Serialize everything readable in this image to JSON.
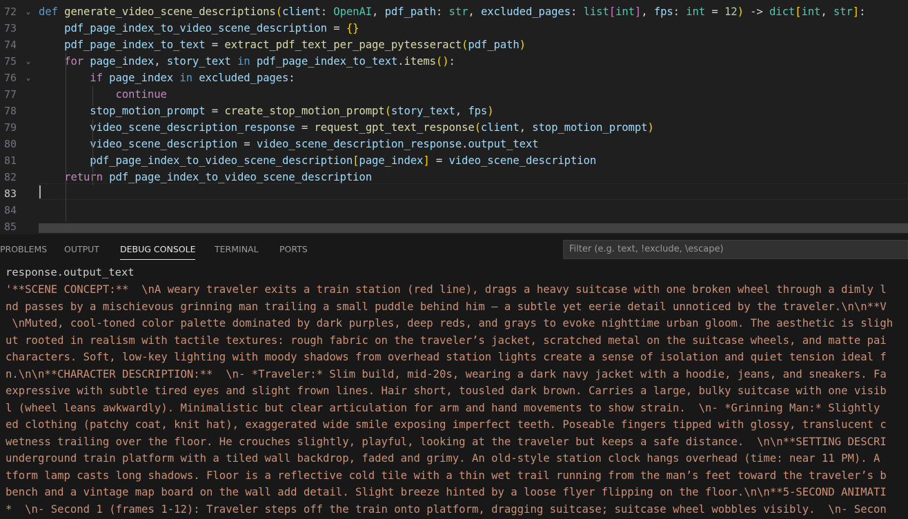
{
  "editor": {
    "lines": [
      {
        "num": "72",
        "fold": "⌄",
        "tokens": [
          {
            "t": "def",
            "c": "kw"
          },
          {
            "t": " ",
            "c": "pl"
          },
          {
            "t": "generate_video_scene_descriptions",
            "c": "fn"
          },
          {
            "t": "(",
            "c": "br1"
          },
          {
            "t": "client",
            "c": "var"
          },
          {
            "t": ": ",
            "c": "pl"
          },
          {
            "t": "OpenAI",
            "c": "typ"
          },
          {
            "t": ", ",
            "c": "pl"
          },
          {
            "t": "pdf_path",
            "c": "var"
          },
          {
            "t": ": ",
            "c": "pl"
          },
          {
            "t": "str",
            "c": "typ"
          },
          {
            "t": ", ",
            "c": "pl"
          },
          {
            "t": "excluded_pages",
            "c": "var"
          },
          {
            "t": ": ",
            "c": "pl"
          },
          {
            "t": "list",
            "c": "typ"
          },
          {
            "t": "[",
            "c": "br2"
          },
          {
            "t": "int",
            "c": "typ"
          },
          {
            "t": "]",
            "c": "br2"
          },
          {
            "t": ", ",
            "c": "pl"
          },
          {
            "t": "fps",
            "c": "var"
          },
          {
            "t": ": ",
            "c": "pl"
          },
          {
            "t": "int",
            "c": "typ"
          },
          {
            "t": " = ",
            "c": "pl"
          },
          {
            "t": "12",
            "c": "num"
          },
          {
            "t": ")",
            "c": "br1"
          },
          {
            "t": " -> ",
            "c": "pl"
          },
          {
            "t": "dict",
            "c": "typ"
          },
          {
            "t": "[",
            "c": "br1"
          },
          {
            "t": "int",
            "c": "typ"
          },
          {
            "t": ", ",
            "c": "pl"
          },
          {
            "t": "str",
            "c": "typ"
          },
          {
            "t": "]",
            "c": "br1"
          },
          {
            "t": ":",
            "c": "pl"
          }
        ]
      },
      {
        "num": "73",
        "fold": "",
        "tokens": [
          {
            "t": "    pdf_page_index_to_video_scene_description",
            "c": "var"
          },
          {
            "t": " = ",
            "c": "pl"
          },
          {
            "t": "{}",
            "c": "br1"
          }
        ]
      },
      {
        "num": "74",
        "fold": "",
        "tokens": [
          {
            "t": "    pdf_page_index_to_text",
            "c": "var"
          },
          {
            "t": " = ",
            "c": "pl"
          },
          {
            "t": "extract_pdf_text_per_page_pytesseract",
            "c": "fn"
          },
          {
            "t": "(",
            "c": "br1"
          },
          {
            "t": "pdf_path",
            "c": "var"
          },
          {
            "t": ")",
            "c": "br1"
          }
        ]
      },
      {
        "num": "75",
        "fold": "⌄",
        "tokens": [
          {
            "t": "    ",
            "c": "pl"
          },
          {
            "t": "for",
            "c": "ctl"
          },
          {
            "t": " page_index",
            "c": "var"
          },
          {
            "t": ", ",
            "c": "pl"
          },
          {
            "t": "story_text",
            "c": "var"
          },
          {
            "t": " in ",
            "c": "kw"
          },
          {
            "t": "pdf_page_index_to_text",
            "c": "var"
          },
          {
            "t": ".",
            "c": "pl"
          },
          {
            "t": "items",
            "c": "fn"
          },
          {
            "t": "()",
            "c": "br1"
          },
          {
            "t": ":",
            "c": "pl"
          }
        ]
      },
      {
        "num": "76",
        "fold": "⌄",
        "tokens": [
          {
            "t": "        ",
            "c": "pl"
          },
          {
            "t": "if",
            "c": "ctl"
          },
          {
            "t": " page_index",
            "c": "var"
          },
          {
            "t": " in ",
            "c": "kw"
          },
          {
            "t": "excluded_pages",
            "c": "var"
          },
          {
            "t": ":",
            "c": "pl"
          }
        ]
      },
      {
        "num": "77",
        "fold": "",
        "tokens": [
          {
            "t": "            ",
            "c": "pl"
          },
          {
            "t": "continue",
            "c": "ctl"
          }
        ]
      },
      {
        "num": "78",
        "fold": "",
        "tokens": [
          {
            "t": "        stop_motion_prompt",
            "c": "var"
          },
          {
            "t": " = ",
            "c": "pl"
          },
          {
            "t": "create_stop_motion_prompt",
            "c": "fn"
          },
          {
            "t": "(",
            "c": "br1"
          },
          {
            "t": "story_text",
            "c": "var"
          },
          {
            "t": ", ",
            "c": "pl"
          },
          {
            "t": "fps",
            "c": "var"
          },
          {
            "t": ")",
            "c": "br1"
          }
        ]
      },
      {
        "num": "79",
        "fold": "",
        "tokens": [
          {
            "t": "        video_scene_description_response",
            "c": "var"
          },
          {
            "t": " = ",
            "c": "pl"
          },
          {
            "t": "request_gpt_text_response",
            "c": "fn"
          },
          {
            "t": "(",
            "c": "br1"
          },
          {
            "t": "client",
            "c": "var"
          },
          {
            "t": ", ",
            "c": "pl"
          },
          {
            "t": "stop_motion_prompt",
            "c": "var"
          },
          {
            "t": ")",
            "c": "br1"
          }
        ]
      },
      {
        "num": "80",
        "fold": "",
        "tokens": [
          {
            "t": "        video_scene_description",
            "c": "var"
          },
          {
            "t": " = ",
            "c": "pl"
          },
          {
            "t": "video_scene_description_response",
            "c": "var"
          },
          {
            "t": ".",
            "c": "pl"
          },
          {
            "t": "output_text",
            "c": "var"
          }
        ]
      },
      {
        "num": "81",
        "fold": "",
        "tokens": [
          {
            "t": "        pdf_page_index_to_video_scene_description",
            "c": "var"
          },
          {
            "t": "[",
            "c": "br1"
          },
          {
            "t": "page_index",
            "c": "var"
          },
          {
            "t": "]",
            "c": "br1"
          },
          {
            "t": " = ",
            "c": "pl"
          },
          {
            "t": "video_scene_description",
            "c": "var"
          }
        ]
      },
      {
        "num": "82",
        "fold": "",
        "tokens": [
          {
            "t": "    ",
            "c": "pl"
          },
          {
            "t": "return",
            "c": "ctl"
          },
          {
            "t": " pdf_page_index_to_video_scene_description",
            "c": "var"
          }
        ]
      },
      {
        "num": "83",
        "fold": "",
        "tokens": []
      },
      {
        "num": "84",
        "fold": "",
        "tokens": []
      },
      {
        "num": "85",
        "fold": "",
        "tokens": []
      }
    ],
    "active_line": "83"
  },
  "panel": {
    "tabs": [
      {
        "label": "PROBLEMS",
        "active": false
      },
      {
        "label": "OUTPUT",
        "active": false
      },
      {
        "label": "DEBUG CONSOLE",
        "active": true
      },
      {
        "label": "TERMINAL",
        "active": false
      },
      {
        "label": "PORTS",
        "active": false
      }
    ],
    "filter_placeholder": "Filter (e.g. text, !exclude, \\escape)",
    "console": {
      "expression": "response.output_text",
      "output_lines": [
        "'**SCENE CONCEPT:**  \\nA weary traveler exits a train station (red line), drags a heavy suitcase with one broken wheel through a dimly l",
        "nd passes by a mischievous grinning man trailing a small puddle behind him — a subtle yet eerie detail unnoticed by the traveler.\\n\\n**V",
        " \\nMuted, cool-toned color palette dominated by dark purples, deep reds, and grays to evoke nighttime urban gloom. The aesthetic is sligh",
        "ut rooted in realism with tactile textures: rough fabric on the traveler’s jacket, scratched metal on the suitcase wheels, and matte pai",
        "characters. Soft, low-key lighting with moody shadows from overhead station lights create a sense of isolation and quiet tension ideal f",
        "n.\\n\\n**CHARACTER DESCRIPTION:**  \\n- *Traveler:* Slim build, mid-20s, wearing a dark navy jacket with a hoodie, jeans, and sneakers. Fa",
        "expressive with subtle tired eyes and slight frown lines. Hair short, tousled dark brown. Carries a large, bulky suitcase with one visib",
        "l (wheel leans awkwardly). Minimalistic but clear articulation for arm and hand movements to show strain.  \\n- *Grinning Man:* Slightly",
        "ed clothing (patchy coat, knit hat), exaggerated wide smile exposing imperfect teeth. Poseable fingers tipped with glossy, translucent c",
        "wetness trailing over the floor. He crouches slightly, playful, looking at the traveler but keeps a safe distance.  \\n\\n**SETTING DESCRI",
        "underground train platform with a tiled wall backdrop, faded and grimy. An old-style station clock hangs overhead (time: near 11 PM). A",
        "tform lamp casts long shadows. Floor is a reflective cold tile with a thin wet trail running from the man’s feet toward the traveler’s b",
        "bench and a vintage map board on the wall add detail. Slight breeze hinted by a loose flyer flipping on the floor.\\n\\n**5-SECOND ANIMATI",
        "*  \\n- Second 1 (frames 1-12): Traveler steps off the train onto platform, dragging suitcase; suitcase wheel wobbles visibly.  \\n- Secon"
      ]
    }
  },
  "colors": {
    "editor_bg": "#1f1f1f",
    "panel_bg": "#181818",
    "string_output": "#ce9178",
    "keyword": "#569cd6",
    "control": "#c586c0",
    "function": "#dcdcaa",
    "variable": "#9cdcfe",
    "type": "#4ec9b0",
    "number": "#b5cea8"
  }
}
